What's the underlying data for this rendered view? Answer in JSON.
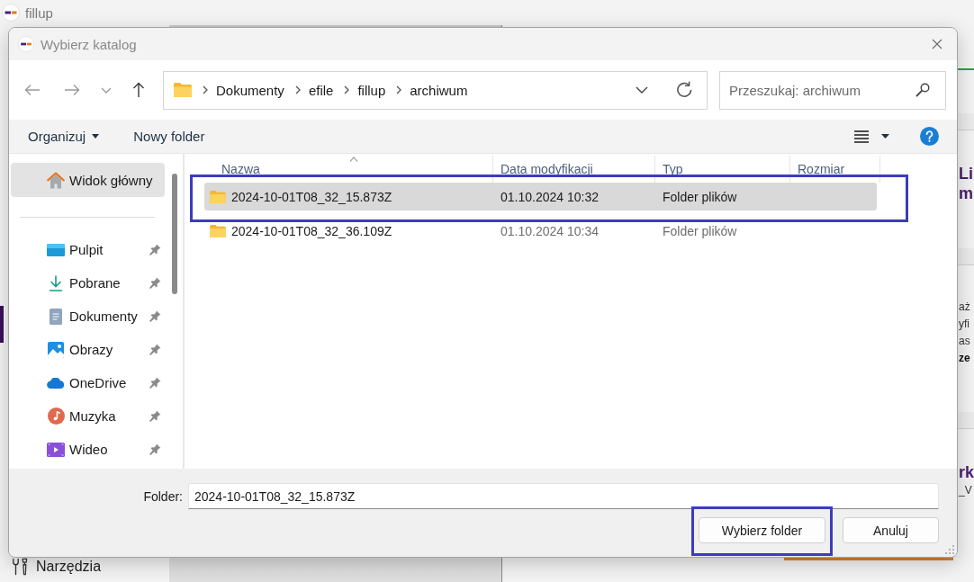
{
  "app": {
    "title": "fillup",
    "nav_item": "Narzędzia"
  },
  "background_panel": {
    "sections": [
      {
        "fragments": [
          {
            "text": "Li",
            "kind": "heading"
          },
          {
            "text": "m",
            "kind": "heading"
          }
        ]
      },
      {
        "fragments": [
          {
            "text": "aż",
            "kind": "text"
          },
          {
            "text": "yfi",
            "kind": "text"
          },
          {
            "text": "as",
            "kind": "text"
          },
          {
            "text": "ze",
            "kind": "bold"
          }
        ]
      },
      {
        "fragments": [
          {
            "text": "rk",
            "kind": "heading"
          },
          {
            "text": "_V",
            "kind": "text"
          }
        ]
      }
    ]
  },
  "dialog": {
    "title": "Wybierz katalog",
    "nav_buttons": [
      {
        "disabled": true
      },
      {
        "disabled": true
      },
      {
        "disabled": true
      },
      {
        "disabled": false
      }
    ],
    "address": {
      "path": [
        "Dokumenty",
        "efile",
        "fillup",
        "archiwum"
      ]
    },
    "search": {
      "placeholder": "Przeszukaj: archiwum"
    },
    "commands": [
      {
        "label": "Organizuj",
        "kind": "menu"
      },
      {
        "label": "Nowy folder",
        "kind": "button"
      }
    ],
    "nav_pane": {
      "home": {
        "label": "Widok główny",
        "selected": true
      },
      "quick_access": [
        {
          "label": "Pulpit",
          "selected": false,
          "pinned": true
        },
        {
          "label": "Pobrane",
          "selected": false,
          "pinned": true
        },
        {
          "label": "Dokumenty",
          "selected": false,
          "pinned": true
        },
        {
          "label": "Obrazy",
          "selected": false,
          "pinned": true
        },
        {
          "label": "OneDrive",
          "selected": false,
          "pinned": true
        },
        {
          "label": "Muzyka",
          "selected": false,
          "pinned": true
        },
        {
          "label": "Wideo",
          "selected": false,
          "pinned": true
        }
      ]
    },
    "file_list": {
      "columns": [
        {
          "label": "Nazwa",
          "sorted": true
        },
        {
          "label": "Data modyfikacji",
          "sorted": false
        },
        {
          "label": "Typ",
          "sorted": false
        },
        {
          "label": "Rozmiar",
          "sorted": false
        }
      ],
      "rows": [
        {
          "name": "2024-10-01T08_32_15.873Z",
          "date": "01.10.2024 10:32",
          "type": "Folder plików",
          "selected": true,
          "highlighted": true
        },
        {
          "name": "2024-10-01T08_32_36.109Z",
          "date": "01.10.2024 10:34",
          "type": "Folder plików",
          "selected": false,
          "highlighted": false
        }
      ]
    },
    "folder_field": {
      "label": "Folder:",
      "value": "2024-10-01T08_32_15.873Z"
    },
    "buttons": [
      {
        "label": "Wybierz folder",
        "highlighted": true
      },
      {
        "label": "Anuluj",
        "highlighted": false
      }
    ]
  }
}
